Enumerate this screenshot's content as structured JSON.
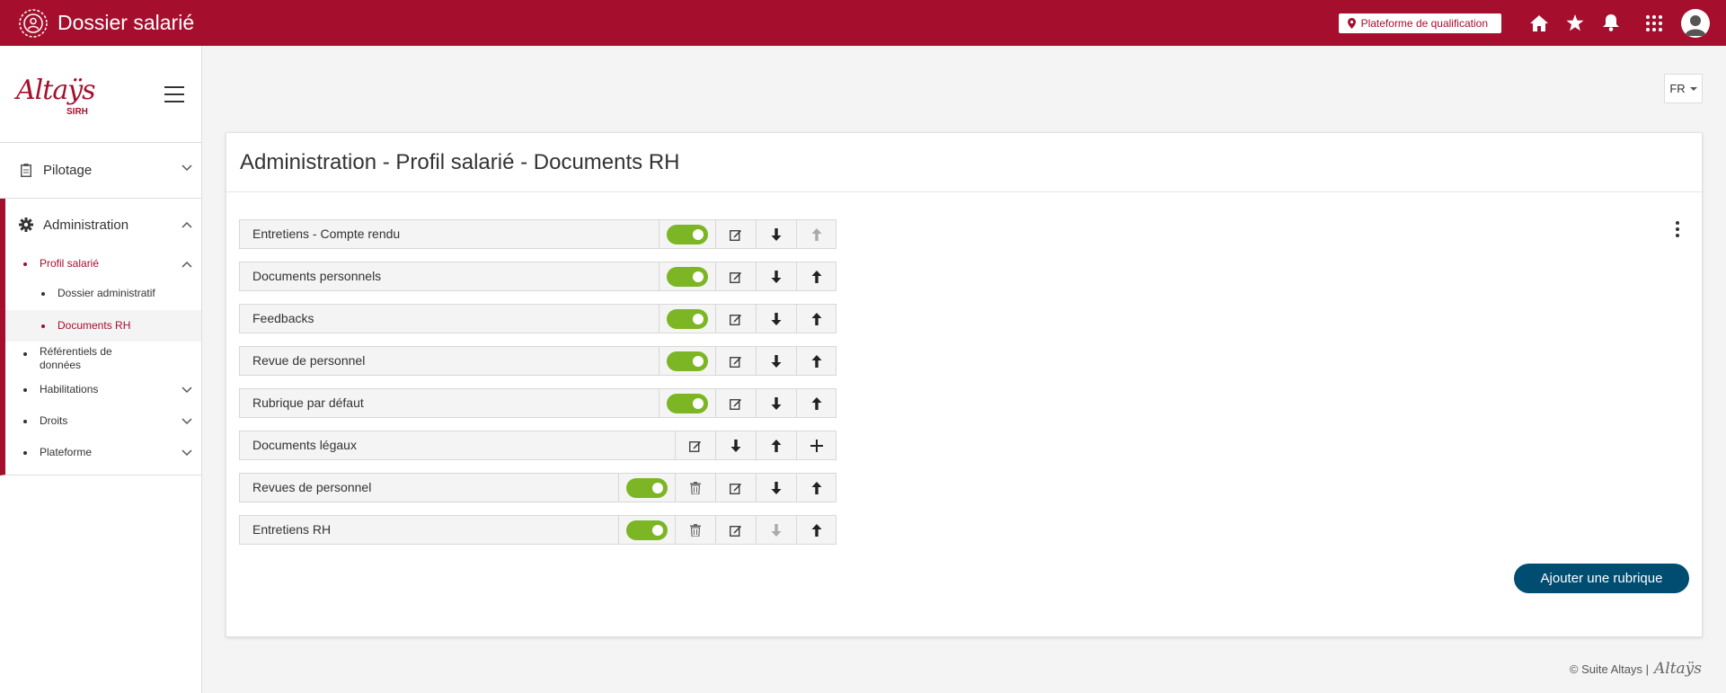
{
  "header": {
    "title": "Dossier salarié",
    "environment_label": "Plateforme de qualification"
  },
  "logo": {
    "script": "Altaÿs",
    "suffix": "SIRH"
  },
  "sidebar": {
    "sections": [
      {
        "label": "Pilotage",
        "icon": "clipboard-icon"
      },
      {
        "label": "Administration",
        "icon": "gear-icon"
      }
    ],
    "admin_items": {
      "profil": "Profil salarié",
      "dossier_administratif": "Dossier administratif",
      "documents_rh": "Documents RH",
      "referentiels": "Référentiels de données",
      "habilitations": "Habilitations",
      "droits": "Droits",
      "plateforme": "Plateforme"
    }
  },
  "language": "FR",
  "page": {
    "title": "Administration - Profil salarié - Documents RH"
  },
  "rubriques": [
    {
      "label": "Entretiens - Compte rendu",
      "enabled": true
    },
    {
      "label": "Documents personnels",
      "enabled": true
    },
    {
      "label": "Feedbacks",
      "enabled": true
    },
    {
      "label": "Revue de personnel",
      "enabled": true
    },
    {
      "label": "Rubrique par défaut",
      "enabled": true
    },
    {
      "label": "Documents légaux",
      "enabled": null
    },
    {
      "label": "Revues de personnel",
      "enabled": true
    },
    {
      "label": "Entretiens RH",
      "enabled": true
    }
  ],
  "actions": {
    "add_rubrique": "Ajouter une rubrique"
  },
  "footer": {
    "text": "© Suite Altays |",
    "logo": "Altaÿs"
  },
  "colors": {
    "brand": "#a50f2d",
    "toggle_on": "#7db624",
    "primary_button": "#004d72"
  }
}
